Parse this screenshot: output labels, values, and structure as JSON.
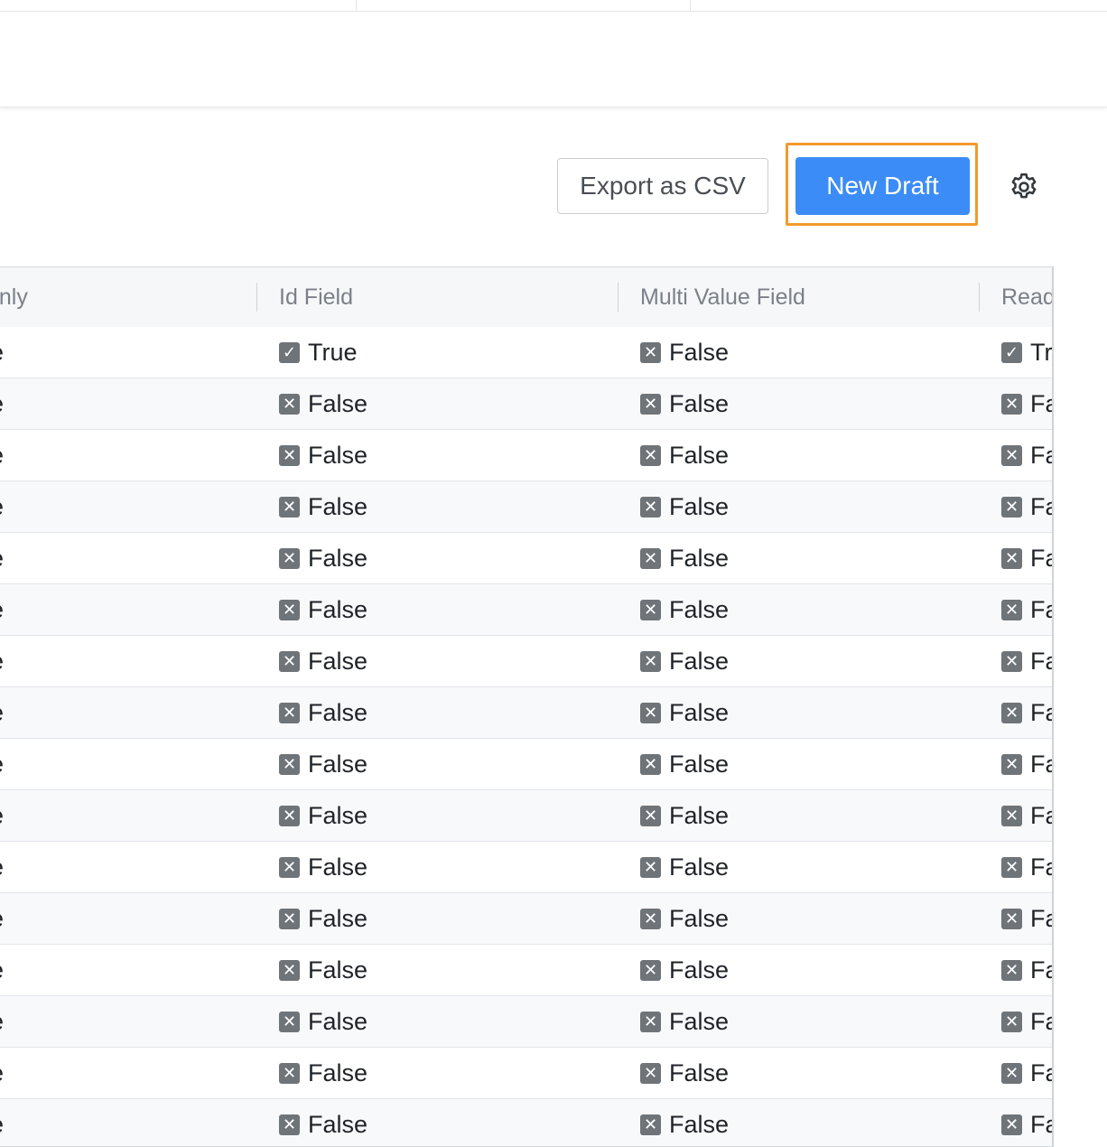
{
  "toolbar": {
    "export_label": "Export as CSV",
    "new_draft_label": "New Draft",
    "settings_icon": "gear-icon"
  },
  "table": {
    "columns": [
      {
        "label": "only"
      },
      {
        "label": "Id Field"
      },
      {
        "label": "Multi Value Field"
      },
      {
        "label": "Read"
      }
    ],
    "rows": [
      {
        "c0": "e",
        "id_field": "True",
        "id_icon": "check",
        "multi": "False",
        "read": "Tr"
      },
      {
        "c0": "e",
        "id_field": "False",
        "id_icon": "x",
        "multi": "False",
        "read": "Fa"
      },
      {
        "c0": "e",
        "id_field": "False",
        "id_icon": "x",
        "multi": "False",
        "read": "Fa"
      },
      {
        "c0": "e",
        "id_field": "False",
        "id_icon": "x",
        "multi": "False",
        "read": "Fa"
      },
      {
        "c0": "e",
        "id_field": "False",
        "id_icon": "x",
        "multi": "False",
        "read": "Fa"
      },
      {
        "c0": "e",
        "id_field": "False",
        "id_icon": "x",
        "multi": "False",
        "read": "Fa"
      },
      {
        "c0": "e",
        "id_field": "False",
        "id_icon": "x",
        "multi": "False",
        "read": "Fa"
      },
      {
        "c0": "e",
        "id_field": "False",
        "id_icon": "x",
        "multi": "False",
        "read": "Fa"
      },
      {
        "c0": "e",
        "id_field": "False",
        "id_icon": "x",
        "multi": "False",
        "read": "Fa"
      },
      {
        "c0": "e",
        "id_field": "False",
        "id_icon": "x",
        "multi": "False",
        "read": "Fa"
      },
      {
        "c0": "e",
        "id_field": "False",
        "id_icon": "x",
        "multi": "False",
        "read": "Fa"
      },
      {
        "c0": "e",
        "id_field": "False",
        "id_icon": "x",
        "multi": "False",
        "read": "Fa"
      },
      {
        "c0": "e",
        "id_field": "False",
        "id_icon": "x",
        "multi": "False",
        "read": "Fa"
      },
      {
        "c0": "e",
        "id_field": "False",
        "id_icon": "x",
        "multi": "False",
        "read": "Fa"
      },
      {
        "c0": "e",
        "id_field": "False",
        "id_icon": "x",
        "multi": "False",
        "read": "Fa"
      },
      {
        "c0": "e",
        "id_field": "False",
        "id_icon": "x",
        "multi": "False",
        "read": "Fa"
      }
    ]
  },
  "colors": {
    "primary": "#3b8cf6",
    "focus_ring": "#f39a2c",
    "icon_gray": "#6f7479"
  }
}
